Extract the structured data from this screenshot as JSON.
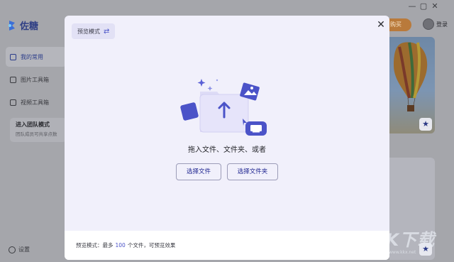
{
  "app": {
    "name": "佐糖",
    "buy_label": "购买",
    "login_label": "登录",
    "sidebar": {
      "items": [
        {
          "label": "我的常用",
          "active": true
        },
        {
          "label": "图片工具箱",
          "active": false
        },
        {
          "label": "视频工具箱",
          "active": false
        }
      ],
      "team": {
        "title": "进入团队模式",
        "subtitle": "团队成员可共享点数"
      },
      "settings_label": "设置"
    },
    "watermark": "KK下载",
    "watermark_sub": "www.kkx.net"
  },
  "modal": {
    "mode_label": "预览模式",
    "drop_hint": "拖入文件、文件夹、或者",
    "buttons": {
      "select_file": "选择文件",
      "select_folder": "选择文件夹"
    },
    "footer": {
      "prefix": "预览模式：最多",
      "count": "100",
      "suffix": "个文件，可预览效果"
    }
  },
  "colors": {
    "accent": "#4b53c8",
    "modal_bg": "#f1f0fb",
    "button_text": "#1f2590",
    "brand": "#2f3f85",
    "buy": "#b97a3b"
  },
  "icons": [
    "logo-icon",
    "swap-icon",
    "close-icon",
    "folder-upload-icon",
    "star-icon",
    "gear-icon"
  ]
}
